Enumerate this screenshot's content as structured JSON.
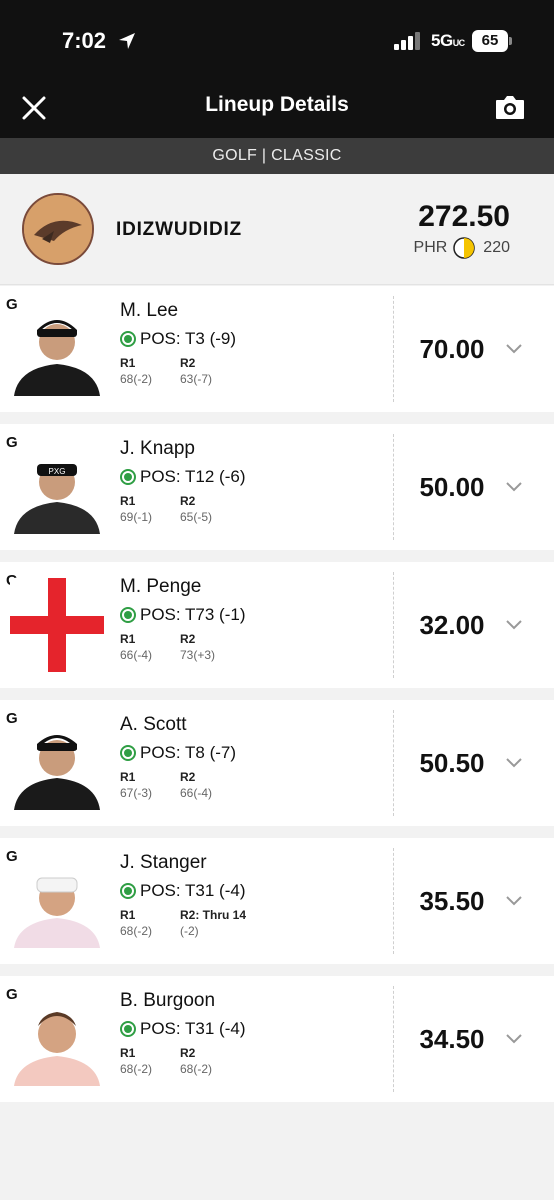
{
  "status_bar": {
    "time": "7:02",
    "network": "5G",
    "network_suffix": "UC",
    "battery": "65"
  },
  "header": {
    "title": "Lineup Details"
  },
  "contest": {
    "label": "GOLF | CLASSIC"
  },
  "user": {
    "name": "IDIZWUDIDIZ",
    "total": "272.50",
    "phr_label": "PHR",
    "phr_value": "220"
  },
  "players": [
    {
      "slot": "G",
      "name": "M. Lee",
      "position": "POS: T3 (-9)",
      "r1_label": "R1",
      "r1_score": "68(-2)",
      "r2_label": "R2",
      "r2_score": "63(-7)",
      "points": "70.00",
      "photo": "player-black-cap"
    },
    {
      "slot": "G",
      "name": "J. Knapp",
      "position": "POS: T12 (-6)",
      "r1_label": "R1",
      "r1_score": "69(-1)",
      "r2_label": "R2",
      "r2_score": "65(-5)",
      "points": "50.00",
      "photo": "player-pxg-cap"
    },
    {
      "slot": "G",
      "name": "M. Penge",
      "position": "POS: T73 (-1)",
      "r1_label": "R1",
      "r1_score": "66(-4)",
      "r2_label": "R2",
      "r2_score": "73(+3)",
      "points": "32.00",
      "photo": "england-flag-cross"
    },
    {
      "slot": "G",
      "name": "A. Scott",
      "position": "POS: T8 (-7)",
      "r1_label": "R1",
      "r1_score": "67(-3)",
      "r2_label": "R2",
      "r2_score": "66(-4)",
      "points": "50.50",
      "photo": "player-black-cap"
    },
    {
      "slot": "G",
      "name": "J. Stanger",
      "position": "POS: T31 (-4)",
      "r1_label": "R1",
      "r1_score": "68(-2)",
      "r2_label": "R2: Thru 14",
      "r2_score": "(-2)",
      "points": "35.50",
      "photo": "player-white-cap"
    },
    {
      "slot": "G",
      "name": "B. Burgoon",
      "position": "POS: T31 (-4)",
      "r1_label": "R1",
      "r1_score": "68(-2)",
      "r2_label": "R2",
      "r2_score": "68(-2)",
      "points": "34.50",
      "photo": "player-no-cap"
    }
  ],
  "colors": {
    "header_bg": "#111111",
    "contest_bar_bg": "#3c3c3c",
    "status_green": "#2f9e44",
    "flag_red": "#e5242c"
  }
}
